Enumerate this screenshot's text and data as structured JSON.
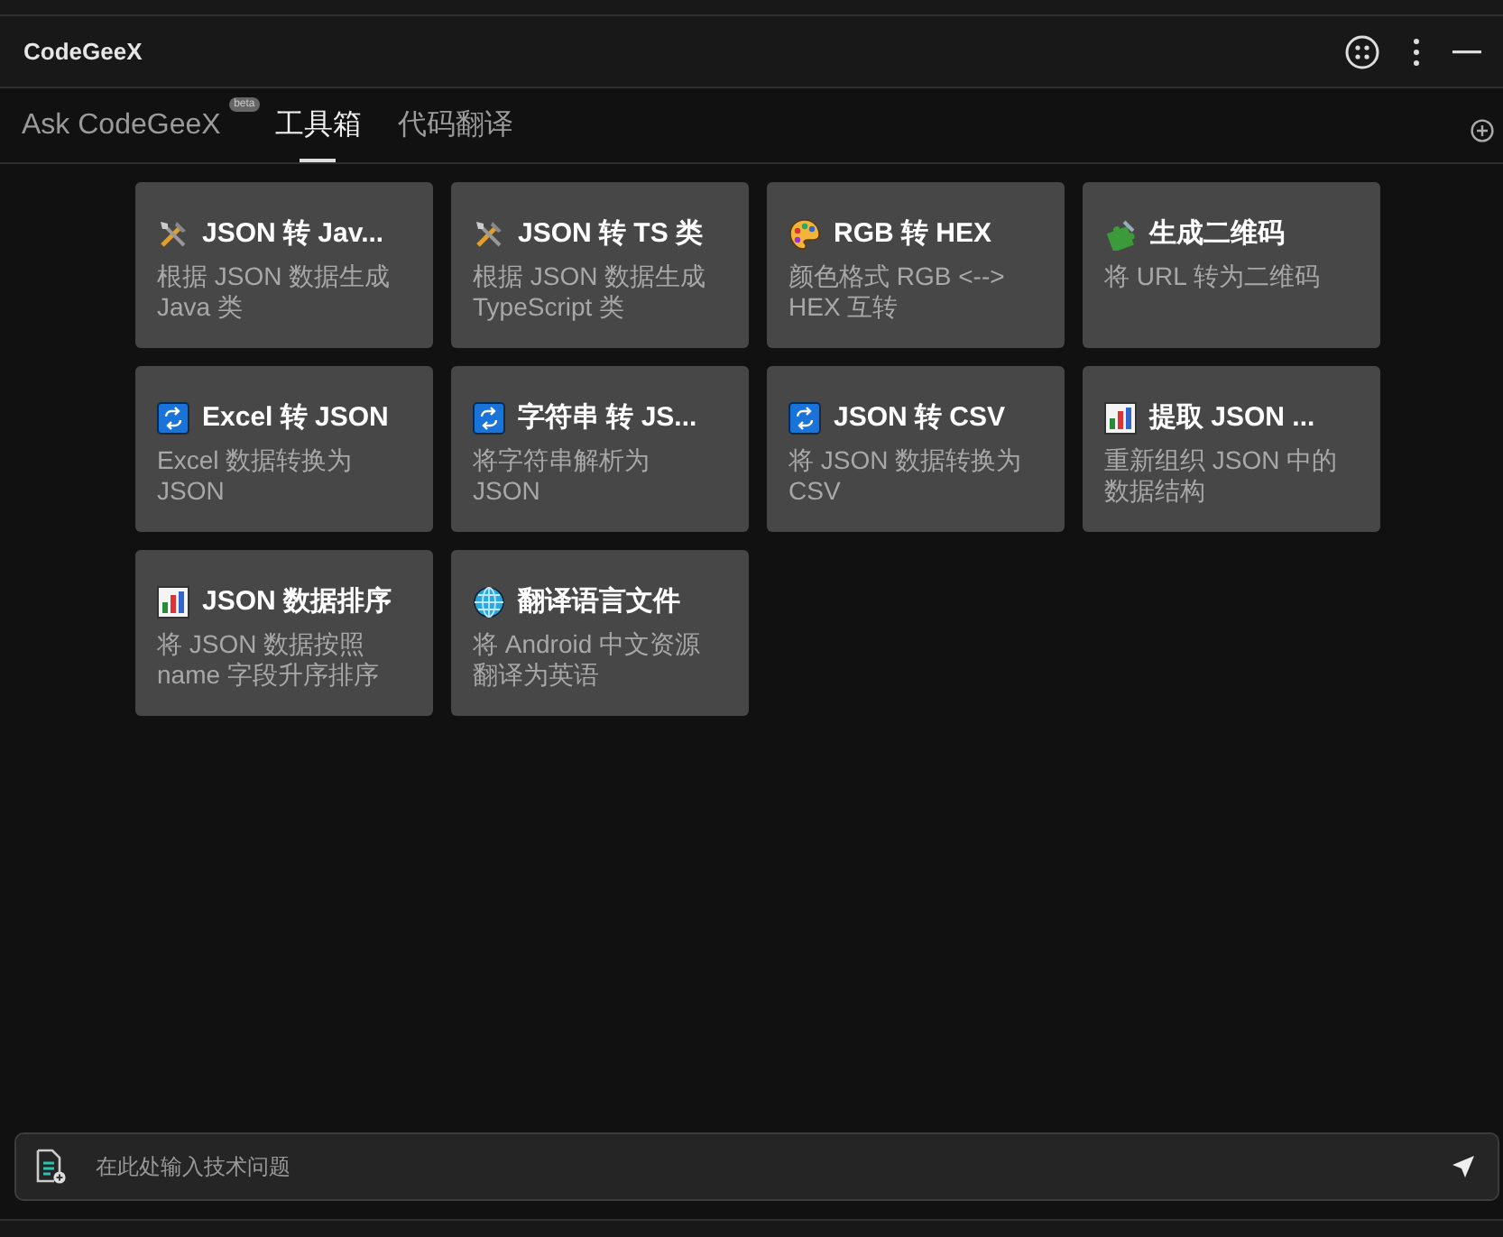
{
  "window": {
    "title": "CodeGeeX"
  },
  "tabs": [
    {
      "label": "Ask CodeGeeX",
      "badge": "beta",
      "selected": false
    },
    {
      "label": "工具箱",
      "selected": true
    },
    {
      "label": "代码翻译",
      "selected": false
    }
  ],
  "tools": [
    {
      "kind": "tools",
      "title": "JSON 转 Jav...",
      "description": "根据 JSON 数据生成 Java 类"
    },
    {
      "kind": "tools",
      "title": "JSON 转 TS 类",
      "description": "根据 JSON 数据生成 TypeScript 类"
    },
    {
      "kind": "palette",
      "title": "RGB 转 HEX",
      "description": "颜色格式 RGB <--> HEX 互转"
    },
    {
      "kind": "puzzle",
      "title": "生成二维码",
      "description": "将 URL 转为二维码"
    },
    {
      "kind": "repeat",
      "title": "Excel 转 JSON",
      "description": "Excel 数据转换为 JSON"
    },
    {
      "kind": "repeat",
      "title": "字符串 转 JS...",
      "description": "将字符串解析为 JSON"
    },
    {
      "kind": "repeat",
      "title": "JSON 转 CSV",
      "description": "将 JSON 数据转换为 CSV"
    },
    {
      "kind": "chart",
      "title": "提取 JSON ...",
      "description": "重新组织 JSON 中的数据结构"
    },
    {
      "kind": "chart",
      "title": "JSON 数据排序",
      "description": "将 JSON 数据按照 name 字段升序排序"
    },
    {
      "kind": "globe",
      "title": "翻译语言文件",
      "description": "将 Android 中文资源翻译为英语"
    }
  ],
  "input": {
    "placeholder": "在此处输入技术问题"
  }
}
